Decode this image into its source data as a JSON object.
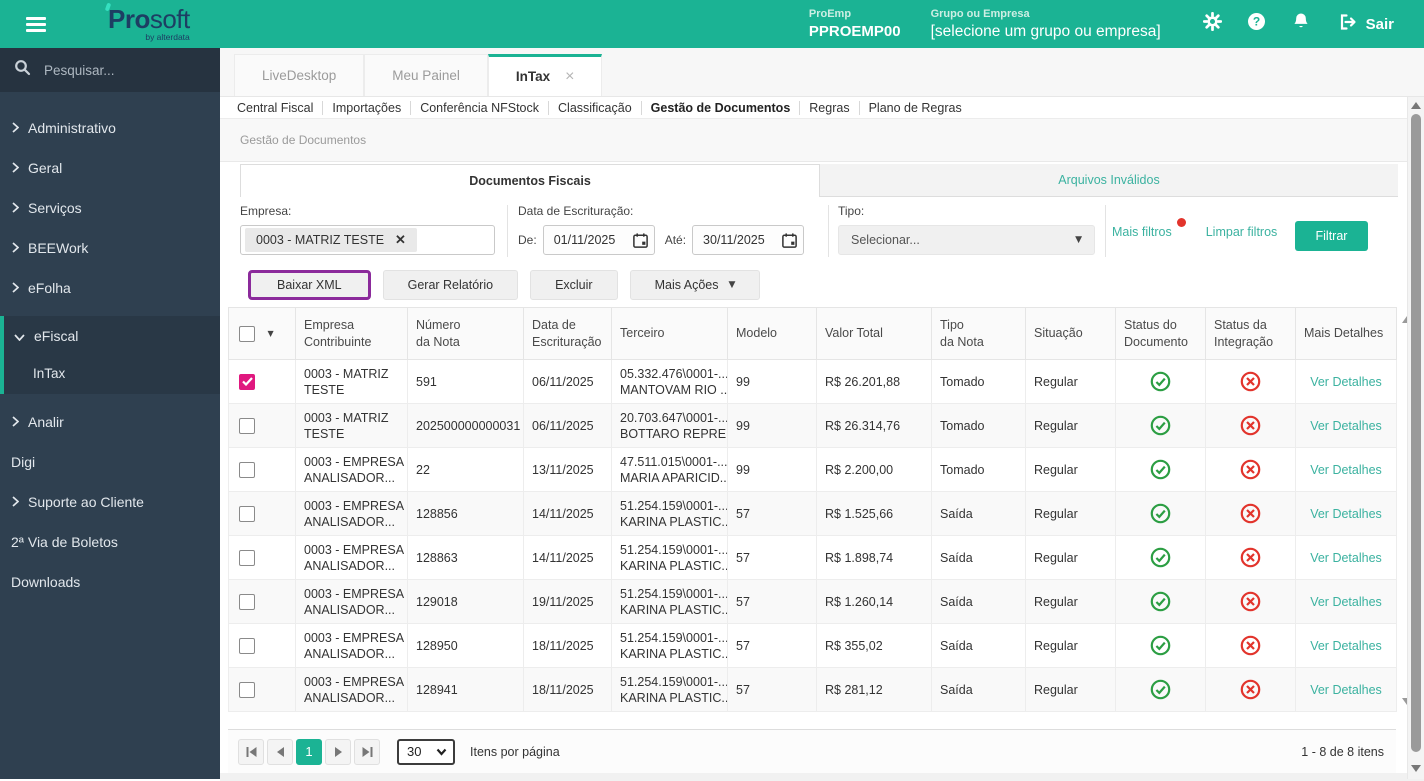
{
  "colors": {
    "brand_teal": "#1bb394",
    "sidebar_bg": "#2f4050",
    "logo_navy": "#1d3e63",
    "checkbox_checked": "#e0187f",
    "status_ok_green": "#2c9e43",
    "status_error_red": "#e2342c",
    "highlight_purple": "#8b2a9b",
    "link_teal": "#3bb2a0"
  },
  "topbar": {
    "logo_pro": "Pro",
    "logo_soft": "soft",
    "logo_byline": "by alterdata",
    "proemp_label": "ProEmp",
    "proemp_value": "PPROEMP00",
    "group_label": "Grupo ou Empresa",
    "group_value": "[selecione um grupo ou empresa]",
    "sair": "Sair"
  },
  "sidebar": {
    "search_placeholder": "Pesquisar...",
    "items": [
      {
        "label": "Administrativo"
      },
      {
        "label": "Geral"
      },
      {
        "label": "Serviços"
      },
      {
        "label": "BEEWork"
      },
      {
        "label": "eFolha"
      },
      {
        "label": "eFiscal"
      },
      {
        "label": "InTax"
      },
      {
        "label": "Analir"
      },
      {
        "label": "Digi"
      },
      {
        "label": "Suporte ao Cliente"
      },
      {
        "label": "2ª Via de Boletos"
      },
      {
        "label": "Downloads"
      }
    ]
  },
  "tabs": {
    "items": [
      "LiveDesktop",
      "Meu Painel",
      "InTax"
    ]
  },
  "subnav": [
    "Central Fiscal",
    "Importações",
    "Conferência NFStock",
    "Classificação",
    "Gestão de Documentos",
    "Regras",
    "Plano de Regras"
  ],
  "breadcrumb": "Gestão de Documentos",
  "panel_tabs": {
    "active": "Documentos Fiscais",
    "inactive": "Arquivos Inválidos"
  },
  "filters": {
    "empresa_label": "Empresa:",
    "empresa_chip": "0003 - MATRIZ TESTE",
    "data_label": "Data de Escrituração:",
    "de_label": "De:",
    "de_value": "01/11/2025",
    "ate_label": "Até:",
    "ate_value": "30/11/2025",
    "tipo_label": "Tipo:",
    "tipo_value": "Selecionar...",
    "mais_filtros": "Mais filtros",
    "limpar_filtros": "Limpar filtros",
    "filtrar": "Filtrar"
  },
  "actions": {
    "baixar_xml": "Baixar XML",
    "gerar_relatorio": "Gerar Relatório",
    "excluir": "Excluir",
    "mais_acoes": "Mais Ações"
  },
  "table": {
    "columns": [
      {
        "l1": "Empresa",
        "l2": "Contribuinte"
      },
      {
        "l1": "Número",
        "l2": "da Nota"
      },
      {
        "l1": "Data de",
        "l2": "Escrituração"
      },
      {
        "l1": "Terceiro",
        "l2": ""
      },
      {
        "l1": "Modelo",
        "l2": ""
      },
      {
        "l1": "Valor Total",
        "l2": ""
      },
      {
        "l1": "Tipo",
        "l2": "da Nota"
      },
      {
        "l1": "Situação",
        "l2": ""
      },
      {
        "l1": "Status do",
        "l2": "Documento"
      },
      {
        "l1": "Status da",
        "l2": "Integração"
      },
      {
        "l1": "Mais Detalhes",
        "l2": ""
      }
    ],
    "rows": [
      {
        "checked": true,
        "empresa1": "0003 - MATRIZ",
        "empresa2": "TESTE",
        "numero": "591",
        "data": "06/11/2025",
        "terceiro1": "05.332.476\\0001-...",
        "terceiro2": "MANTOVAM RIO ...",
        "modelo": "99",
        "valor": "R$ 26.201,88",
        "tipo": "Tomado",
        "situacao": "Regular",
        "status_doc": "ok",
        "status_int": "error",
        "detalhes": "Ver Detalhes"
      },
      {
        "checked": false,
        "empresa1": "0003 - MATRIZ",
        "empresa2": "TESTE",
        "numero": "202500000000031",
        "data": "06/11/2025",
        "terceiro1": "20.703.647\\0001-...",
        "terceiro2": "BOTTARO REPRE...",
        "modelo": "99",
        "valor": "R$ 26.314,76",
        "tipo": "Tomado",
        "situacao": "Regular",
        "status_doc": "ok",
        "status_int": "error",
        "detalhes": "Ver Detalhes"
      },
      {
        "checked": false,
        "empresa1": "0003 - EMPRESA",
        "empresa2": "ANALISADOR...",
        "numero": "22",
        "data": "13/11/2025",
        "terceiro1": "47.511.015\\0001-...",
        "terceiro2": "MARIA APARICID...",
        "modelo": "99",
        "valor": "R$ 2.200,00",
        "tipo": "Tomado",
        "situacao": "Regular",
        "status_doc": "ok",
        "status_int": "error",
        "detalhes": "Ver Detalhes"
      },
      {
        "checked": false,
        "empresa1": "0003 - EMPRESA",
        "empresa2": "ANALISADOR...",
        "numero": "128856",
        "data": "14/11/2025",
        "terceiro1": "51.254.159\\0001-...",
        "terceiro2": "KARINA PLASTIC...",
        "modelo": "57",
        "valor": "R$ 1.525,66",
        "tipo": "Saída",
        "situacao": "Regular",
        "status_doc": "ok",
        "status_int": "error",
        "detalhes": "Ver Detalhes"
      },
      {
        "checked": false,
        "empresa1": "0003 - EMPRESA",
        "empresa2": "ANALISADOR...",
        "numero": "128863",
        "data": "14/11/2025",
        "terceiro1": "51.254.159\\0001-...",
        "terceiro2": "KARINA PLASTIC...",
        "modelo": "57",
        "valor": "R$ 1.898,74",
        "tipo": "Saída",
        "situacao": "Regular",
        "status_doc": "ok",
        "status_int": "error",
        "detalhes": "Ver Detalhes"
      },
      {
        "checked": false,
        "empresa1": "0003 - EMPRESA",
        "empresa2": "ANALISADOR...",
        "numero": "129018",
        "data": "19/11/2025",
        "terceiro1": "51.254.159\\0001-...",
        "terceiro2": "KARINA PLASTIC...",
        "modelo": "57",
        "valor": "R$ 1.260,14",
        "tipo": "Saída",
        "situacao": "Regular",
        "status_doc": "ok",
        "status_int": "error",
        "detalhes": "Ver Detalhes"
      },
      {
        "checked": false,
        "empresa1": "0003 - EMPRESA",
        "empresa2": "ANALISADOR...",
        "numero": "128950",
        "data": "18/11/2025",
        "terceiro1": "51.254.159\\0001-...",
        "terceiro2": "KARINA PLASTIC...",
        "modelo": "57",
        "valor": "R$ 355,02",
        "tipo": "Saída",
        "situacao": "Regular",
        "status_doc": "ok",
        "status_int": "error",
        "detalhes": "Ver Detalhes"
      },
      {
        "checked": false,
        "empresa1": "0003 - EMPRESA",
        "empresa2": "ANALISADOR...",
        "numero": "128941",
        "data": "18/11/2025",
        "terceiro1": "51.254.159\\0001-...",
        "terceiro2": "KARINA PLASTIC...",
        "modelo": "57",
        "valor": "R$ 281,12",
        "tipo": "Saída",
        "situacao": "Regular",
        "status_doc": "ok",
        "status_int": "error",
        "detalhes": "Ver Detalhes"
      }
    ]
  },
  "footer": {
    "page": "1",
    "page_size": "30",
    "items_label": "Itens por página",
    "range_label": "1 - 8 de 8 itens"
  }
}
